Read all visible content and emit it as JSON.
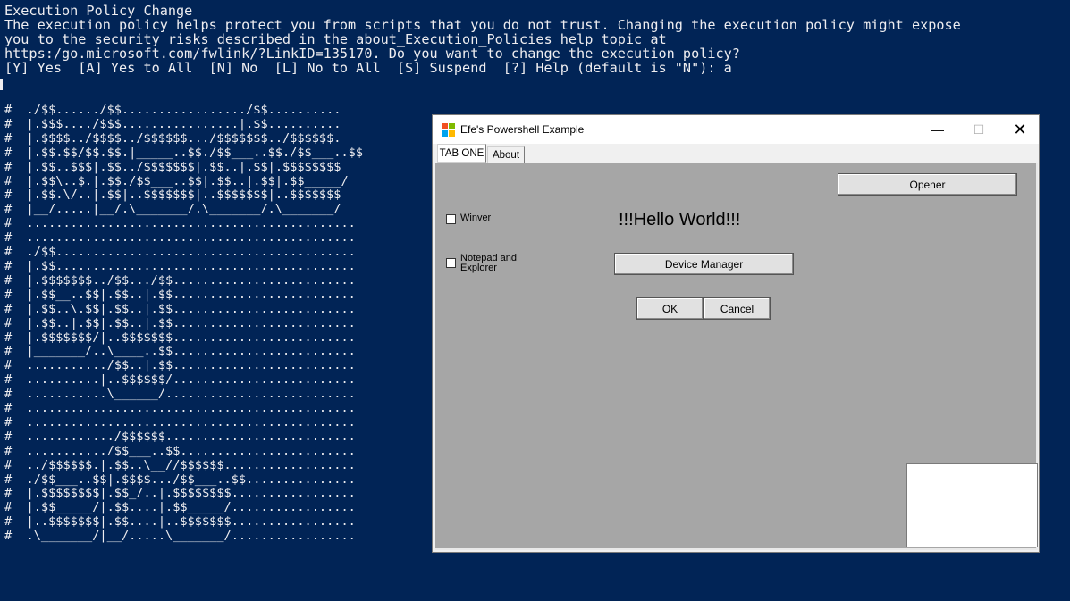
{
  "console": {
    "lines": [
      "Execution Policy Change",
      "The execution policy helps protect you from scripts that you do not trust. Changing the execution policy might expose",
      "you to the security risks described in the about_Execution_Policies help topic at",
      "https:/go.microsoft.com/fwlink/?LinkID=135170. Do you want to change the execution policy?",
      "[Y] Yes  [A] Yes to All  [N] No  [L] No to All  [S] Suspend  [?] Help (default is \"N\"): a"
    ],
    "art_lines": [
      "#  ./$$....../$$................./$$..........",
      "#  |.$$$..../$$$................|.$$..........",
      "#  |.$$$$../$$$$../$$$$$$.../$$$$$$$../$$$$$$.",
      "#  |.$$.$$/$$.$$.|_____..$$./$$___..$$./$$___..$$",
      "#  |.$$..$$$|.$$../$$$$$$$|.$$..|.$$|.$$$$$$$$",
      "#  |.$$\\..$.|.$$./$$___..$$|.$$..|.$$|.$$_____/",
      "#  |.$$.\\/..|.$$|..$$$$$$$|..$$$$$$$|..$$$$$$$",
      "#  |__/.....|__/.\\_______/.\\_______/.\\_______/",
      "#  .............................................",
      "#  .............................................",
      "#  ./$$.........................................",
      "#  |.$$.........................................",
      "#  |.$$$$$$$../$$.../$$.........................",
      "#  |.$$__..$$|.$$..|.$$.........................",
      "#  |.$$..\\.$$|.$$..|.$$.........................",
      "#  |.$$..|.$$|.$$..|.$$.........................",
      "#  |.$$$$$$$/|..$$$$$$$.........................",
      "#  |_______/..\\____..$$.........................",
      "#  .........../$$..|.$$.........................",
      "#  ..........|..$$$$$$/.........................",
      "#  ...........\\______/..........................",
      "#  .............................................",
      "#  .............................................",
      "#  ............/$$$$$$..........................",
      "#  .........../$$___..$$........................",
      "#  ../$$$$$$.|.$$..\\__//$$$$$$..................",
      "#  ./$$___..$$|.$$$$.../$$___..$$...............",
      "#  |.$$$$$$$$|.$$_/..|.$$$$$$$$.................",
      "#  |.$$_____/|.$$....|.$$_____/.................",
      "#  |..$$$$$$$|.$$....|..$$$$$$$.................",
      "#  .\\_______/|__/.....\\_______/................."
    ]
  },
  "window": {
    "title": "Efe's Powershell Example",
    "controls": {
      "minimize": "—",
      "maximize": "☐",
      "close": "✕"
    },
    "tabs": [
      {
        "label": "TAB ONE"
      },
      {
        "label": "About"
      }
    ],
    "checkboxes": [
      {
        "label": "Winver",
        "checked": false
      },
      {
        "label": "Notepad and Explorer",
        "checked": false
      }
    ],
    "hello_label": "!!!Hello World!!!",
    "buttons": {
      "opener": "Opener",
      "device_manager": "Device Manager",
      "ok": "OK",
      "cancel": "Cancel"
    }
  },
  "colors": {
    "console_bg": "#012456",
    "console_fg": "#eeedf0",
    "panel_bg": "#a6a6a6"
  }
}
